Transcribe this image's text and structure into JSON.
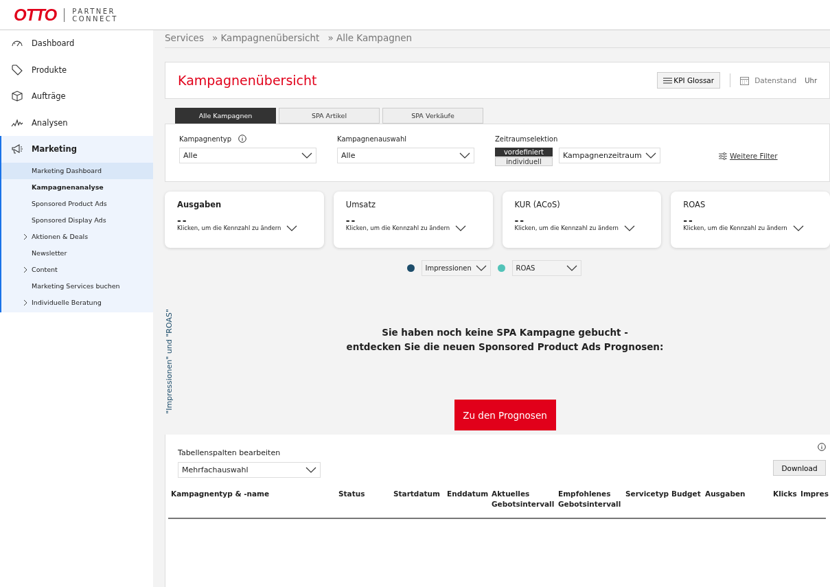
{
  "header": {
    "logo": "OTTO",
    "product_line1": "PARTNER",
    "product_line2": "CONNECT"
  },
  "sidebar": {
    "items": [
      {
        "label": "Dashboard",
        "selected": false
      },
      {
        "label": "Produkte",
        "selected": false
      },
      {
        "label": "Aufträge",
        "selected": false
      },
      {
        "label": "Analysen",
        "selected": false
      },
      {
        "label": "Marketing",
        "selected": true,
        "children": [
          {
            "label": "Marketing Dashboard",
            "kind": "link",
            "selected": true,
            "active": false
          },
          {
            "label": "Kampagnenanalyse",
            "kind": "link",
            "selected": false,
            "active": true
          },
          {
            "label": "Sponsored Product Ads",
            "kind": "link",
            "selected": false,
            "active": false
          },
          {
            "label": "Sponsored Display Ads",
            "kind": "link",
            "selected": false,
            "active": false
          },
          {
            "label": "Aktionen & Deals",
            "kind": "group",
            "selected": false,
            "active": false
          },
          {
            "label": "Newsletter",
            "kind": "link",
            "selected": false,
            "active": false
          },
          {
            "label": "Content",
            "kind": "group",
            "selected": false,
            "active": false
          },
          {
            "label": "Marketing Services buchen",
            "kind": "link",
            "selected": false,
            "active": false
          },
          {
            "label": "Individuelle Beratung",
            "kind": "group",
            "selected": false,
            "active": false
          }
        ]
      }
    ]
  },
  "breadcrumb": [
    "Services",
    "» Kampagnenübersicht",
    "» Alle Kampagnen"
  ],
  "page": {
    "title": "Kampagnenübersicht",
    "kpi_button": "KPI Glossar",
    "data_status_label": "Datenstand",
    "data_status_value": "Uhr"
  },
  "tabs": [
    {
      "label": "Alle Kampagnen",
      "selected": true
    },
    {
      "label": "SPA Artikel",
      "selected": false
    },
    {
      "label": "SPA Verkäufe",
      "selected": false
    }
  ],
  "filters": {
    "campaign_type": {
      "label": "Kampagnentyp",
      "value": "Alle"
    },
    "campaign_selection": {
      "label": "Kampagnenauswahl",
      "value": "Alle"
    },
    "period": {
      "label": "Zeitraumselektion",
      "options": [
        {
          "label": "vordefiniert",
          "selected": true
        },
        {
          "label": "individuell",
          "selected": false
        }
      ],
      "value": "Kampagnenzeitraum"
    },
    "more_filters": "Weitere Filter"
  },
  "kpi_cards": [
    {
      "title": "Ausgaben",
      "value": "--",
      "hint": "Klicken, um die Kennzahl zu ändern"
    },
    {
      "title": "Umsatz",
      "value": "--",
      "hint": "Klicken, um die Kennzahl zu ändern"
    },
    {
      "title": "KUR (ACoS)",
      "value": "--",
      "hint": "Klicken, um die Kennzahl zu ändern"
    },
    {
      "title": "ROAS",
      "value": "--",
      "hint": "Klicken, um die Kennzahl zu ändern"
    }
  ],
  "chart": {
    "legend": [
      {
        "value": "Impressionen",
        "color": "#1d4d6b"
      },
      {
        "value": "ROAS",
        "color": "#52c3b8"
      }
    ],
    "axis_label": "\"Impressionen\" und \"ROAS\"",
    "message_line1": "Sie haben noch keine SPA Kampagne gebucht -",
    "message_line2": "entdecken Sie die neuen Sponsored Product Ads Prognosen:",
    "button": "Zu den Prognosen"
  },
  "table": {
    "columns_label": "Tabellenspalten bearbeiten",
    "columns_value": "Mehrfachauswahl",
    "download": "Download",
    "columns": [
      "Kampagnentyp & -name",
      "Status",
      "Startdatum",
      "Enddatum",
      "Aktuelles Gebotsintervall",
      "Empfohlenes Gebotsintervall",
      "Servicetyp",
      "Budget",
      "Ausgaben",
      "Klicks",
      "Impres"
    ]
  }
}
